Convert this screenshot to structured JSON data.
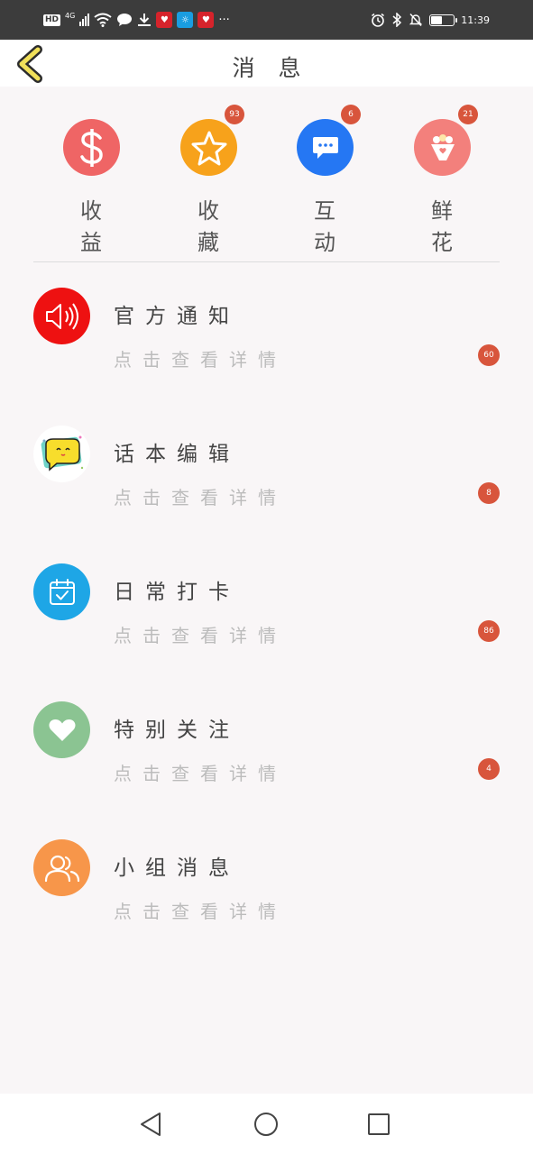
{
  "status_bar": {
    "hd": "HD",
    "network": "4G",
    "time": "11:39",
    "battery_level": 0.45
  },
  "header": {
    "title": "消 息",
    "back_icon": "chevron-left-icon"
  },
  "quick": [
    {
      "label": "收益",
      "icon": "dollar-icon",
      "color": "#ef6565",
      "badge": ""
    },
    {
      "label": "收藏",
      "icon": "star-icon",
      "color": "#f7a21b",
      "badge": "93"
    },
    {
      "label": "互动",
      "icon": "chat-bubble-icon",
      "color": "#2577f3",
      "badge": "6"
    },
    {
      "label": "鲜花",
      "icon": "flower-bouquet-icon",
      "color": "#f3807c",
      "badge": "21"
    }
  ],
  "messages": [
    {
      "title": "官方通知",
      "subtitle": "点击查看详情",
      "badge": "60",
      "icon": "speaker-icon",
      "color": "#ee1111"
    },
    {
      "title": "话本编辑",
      "subtitle": "点击查看详情",
      "badge": "8",
      "icon": "chat-mascot-icon",
      "color": "#ffffff"
    },
    {
      "title": "日常打卡",
      "subtitle": "点击查看详情",
      "badge": "86",
      "icon": "calendar-check-icon",
      "color": "#1ea6e6"
    },
    {
      "title": "特别关注",
      "subtitle": "点击查看详情",
      "badge": "4",
      "icon": "heart-icon",
      "color": "#8bc492"
    },
    {
      "title": "小组消息",
      "subtitle": "点击查看详情",
      "badge": "",
      "icon": "group-icon",
      "color": "#f7964a"
    }
  ],
  "nav": {
    "back_icon": "triangle-back-icon",
    "home_icon": "circle-home-icon",
    "recents_icon": "square-recents-icon"
  }
}
